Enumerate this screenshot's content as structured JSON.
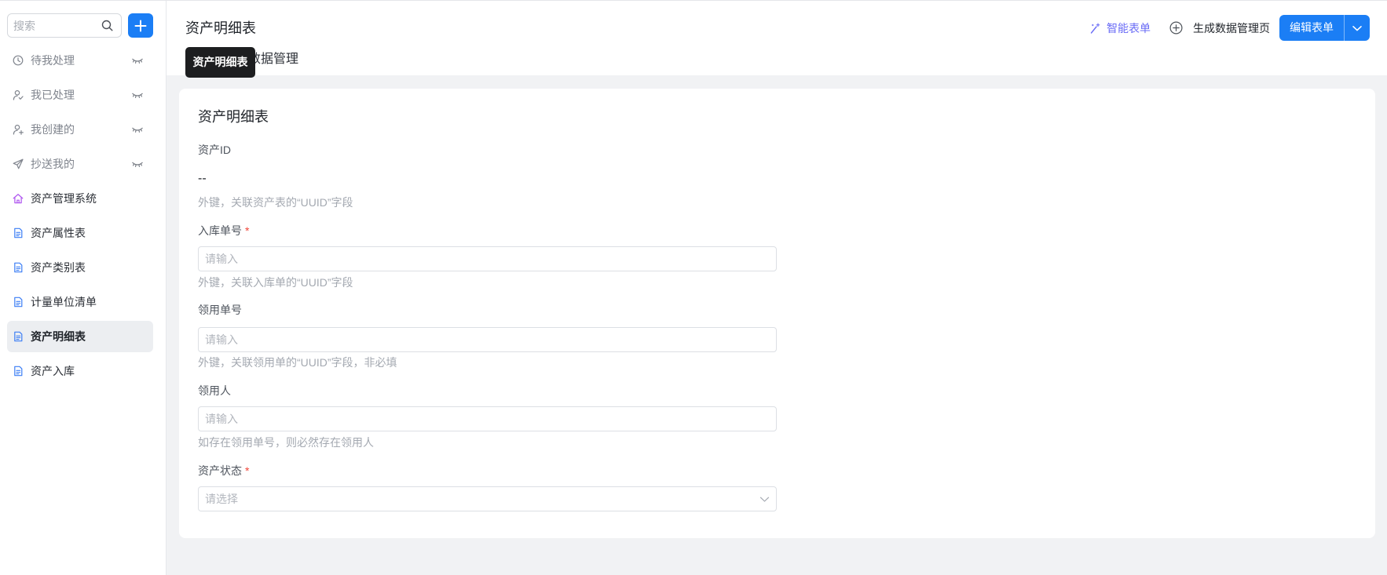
{
  "colors": {
    "primary": "#1b7ef5",
    "smart_form": "#6a6cf6",
    "required": "#f04438",
    "page_bg": "#f1f2f4",
    "home_icon": "#b25cf0",
    "document_icon": "#3d7ff5"
  },
  "sidebar": {
    "search": {
      "placeholder": "搜索",
      "icon": "search-icon"
    },
    "add_button_icon": "plus-icon",
    "items": [
      {
        "label": "待我处理",
        "icon": "clock-icon",
        "trailing_icon": "eye-closed-icon"
      },
      {
        "label": "我已处理",
        "icon": "user-check-icon",
        "trailing_icon": "eye-closed-icon"
      },
      {
        "label": "我创建的",
        "icon": "user-add-icon",
        "trailing_icon": "eye-closed-icon"
      },
      {
        "label": "抄送我的",
        "icon": "send-icon",
        "trailing_icon": "eye-closed-icon"
      },
      {
        "label": "资产管理系统",
        "icon": "home-icon"
      },
      {
        "label": "资产属性表",
        "icon": "document-icon"
      },
      {
        "label": "资产类别表",
        "icon": "document-icon"
      },
      {
        "label": "计量单位清单",
        "icon": "document-icon"
      },
      {
        "label": "资产明细表",
        "icon": "document-icon",
        "selected": true
      },
      {
        "label": "资产入库",
        "icon": "document-icon"
      }
    ]
  },
  "header": {
    "title": "资产明细表",
    "tabs": [
      {
        "label": "数据管理"
      }
    ],
    "tooltip": "资产明细表",
    "actions": {
      "smart_form_label": "智能表单",
      "smart_form_icon": "magic-wand-icon",
      "generate_page_label": "生成数据管理页",
      "generate_page_icon": "plus-circle-icon",
      "edit_form_label": "编辑表单",
      "edit_form_dropdown_icon": "chevron-down-icon"
    }
  },
  "form": {
    "title": "资产明细表",
    "required_mark": "*",
    "fields": [
      {
        "label": "资产ID",
        "required": false,
        "type": "text",
        "value": "--",
        "help": "外键，关联资产表的“UUID”字段"
      },
      {
        "label": "入库单号",
        "required": true,
        "type": "input",
        "placeholder": "请输入",
        "help": "外键，关联入库单的“UUID”字段"
      },
      {
        "label": "领用单号",
        "required": false,
        "type": "input",
        "placeholder": "请输入",
        "help": "外键，关联领用单的“UUID”字段，非必填"
      },
      {
        "label": "领用人",
        "required": false,
        "type": "input",
        "placeholder": "请输入",
        "help": "如存在领用单号，则必然存在领用人"
      },
      {
        "label": "资产状态",
        "required": true,
        "type": "select",
        "placeholder": "请选择"
      }
    ]
  }
}
